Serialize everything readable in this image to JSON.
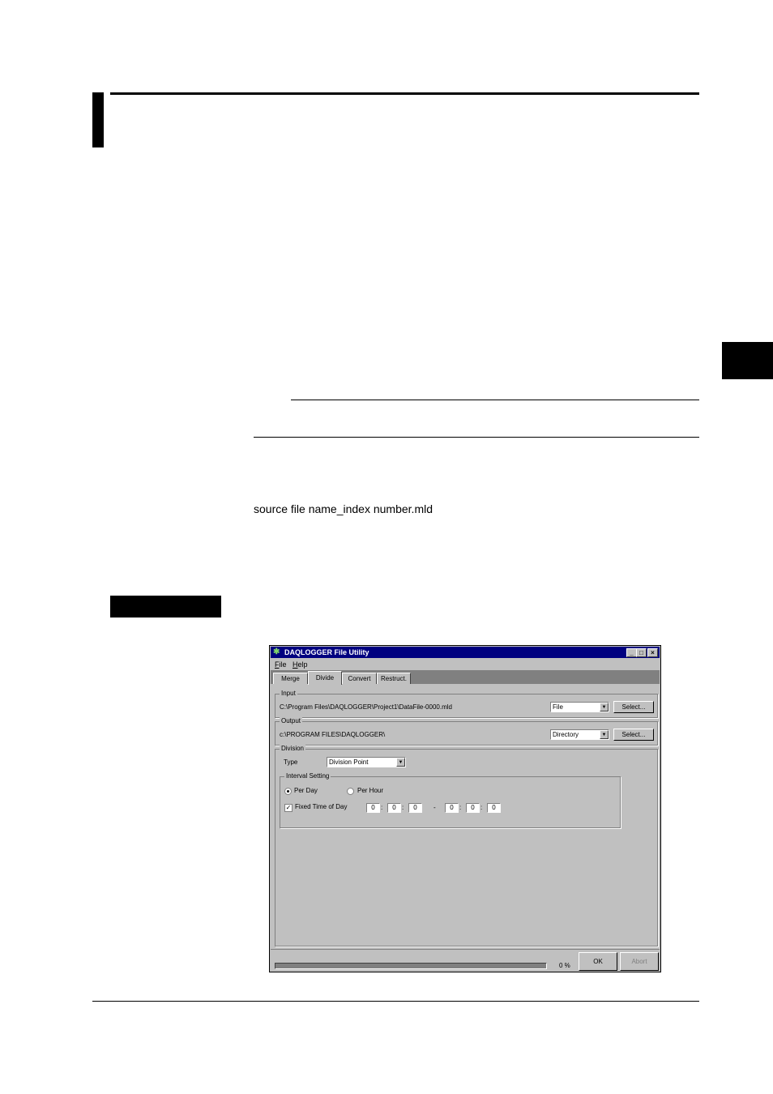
{
  "page": {
    "source_line": "source file name_index number.mld"
  },
  "window": {
    "title": "DAQLOGGER File Utility",
    "controls": {
      "minimize": "_",
      "maximize": "□",
      "close": "×"
    },
    "menu": [
      {
        "label": "File",
        "accel": "F",
        "rest": "ile"
      },
      {
        "label": "Help",
        "accel": "H",
        "rest": "elp"
      }
    ],
    "tabs": [
      "Merge",
      "Divide",
      "Convert",
      "Restruct."
    ],
    "active_tab": "Divide",
    "input": {
      "group_label": "Input",
      "path": "C:\\Program Files\\DAQLOGGER\\Project1\\DataFile-0000.mld",
      "type_value": "File",
      "select_label": "Select..."
    },
    "output": {
      "group_label": "Output",
      "path": "c:\\PROGRAM FILES\\DAQLOGGER\\",
      "type_value": "Directory",
      "select_label": "Select..."
    },
    "division": {
      "group_label": "Division",
      "type_label": "Type",
      "type_value": "Division Point",
      "interval": {
        "group_label": "Interval Setting",
        "per_day_label": "Per Day",
        "per_day_selected": true,
        "per_hour_label": "Per Hour",
        "per_hour_selected": false,
        "fixed_label": "Fixed Time of Day",
        "fixed_checked": true,
        "check_mark": "✓",
        "from": {
          "h": "0",
          "m": "0",
          "s": "0"
        },
        "to": {
          "h": "0",
          "m": "0",
          "s": "0"
        },
        "time_sep": ":",
        "range_sep": "-"
      }
    },
    "status": {
      "progress_percent": 0,
      "progress_text": "0 %",
      "ok_label": "OK",
      "abort_label": "Abort"
    }
  }
}
